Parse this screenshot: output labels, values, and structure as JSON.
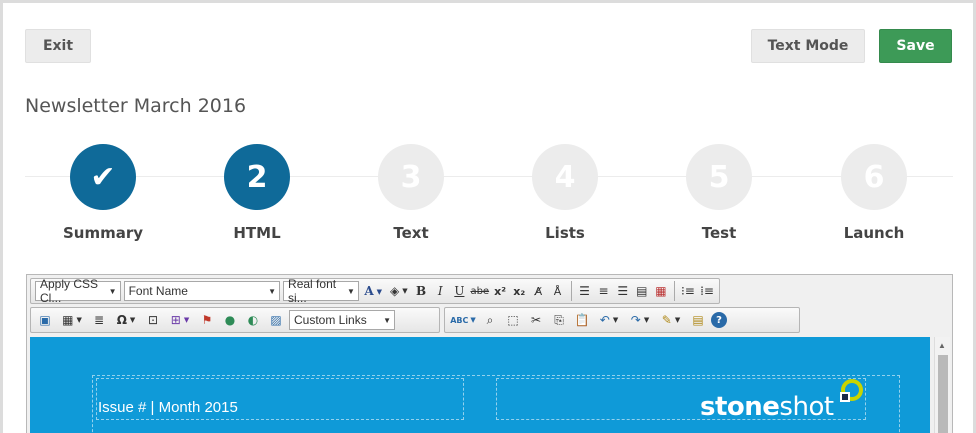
{
  "header": {
    "exit_label": "Exit",
    "text_mode_label": "Text Mode",
    "save_label": "Save"
  },
  "page_title": "Newsletter March 2016",
  "steps": [
    {
      "number": "✔",
      "label": "Summary",
      "state": "complete"
    },
    {
      "number": "2",
      "label": "HTML",
      "state": "active"
    },
    {
      "number": "3",
      "label": "Text",
      "state": "inactive"
    },
    {
      "number": "4",
      "label": "Lists",
      "state": "inactive"
    },
    {
      "number": "5",
      "label": "Test",
      "state": "inactive"
    },
    {
      "number": "6",
      "label": "Launch",
      "state": "inactive"
    }
  ],
  "toolbar": {
    "css_class_select": "Apply CSS Cl...",
    "font_name_select": "Font Name",
    "font_size_select": "Real font si...",
    "custom_links_select": "Custom Links",
    "spell_check_label": "ABC",
    "icons_row1": [
      "font-color-icon",
      "highlight-color-icon",
      "bold-icon",
      "italic-icon",
      "underline-icon",
      "strikethrough-icon",
      "superscript-icon",
      "subscript-icon",
      "format-stripper-icon",
      "clear-format-icon",
      "align-left-icon",
      "align-center-icon",
      "align-right-icon",
      "justify-icon",
      "remove-alignment-icon",
      "numbered-list-icon",
      "bullet-list-icon"
    ],
    "icons_row2": [
      "image-manager-icon",
      "insert-table-icon",
      "horizontal-rule-icon",
      "special-chars-icon",
      "insert-form-icon",
      "insert-snippet-icon",
      "link-manager-icon",
      "hyperlink-icon",
      "unlink-icon",
      "flash-manager-icon",
      "spellcheck-icon",
      "find-icon",
      "select-all-icon",
      "cut-icon",
      "copy-icon",
      "paste-icon",
      "undo-icon",
      "redo-icon",
      "format-painter-icon",
      "paste-from-word-icon",
      "help-icon"
    ]
  },
  "email_preview": {
    "issue_text": "Issue # | Month 2015",
    "logo_text_bold": "stone",
    "logo_text_regular": "shot"
  },
  "colors": {
    "save_green": "#3d9a57",
    "step_active": "#0f6a99",
    "step_inactive": "#ececec",
    "email_header_blue": "#0f9ad8"
  }
}
